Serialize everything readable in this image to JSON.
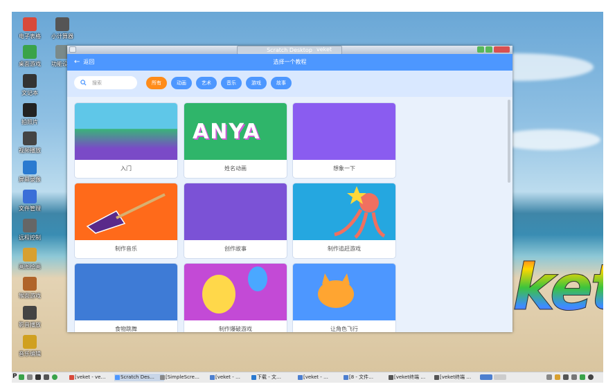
{
  "desktop": {
    "icons": [
      {
        "label": "电子表格",
        "icon": "spreadsheet-icon",
        "color": "#d84a3b"
      },
      {
        "label": "小计算器",
        "icon": "calculator-icon",
        "color": "#555555"
      },
      {
        "label": "桌面游戏",
        "icon": "game-icon",
        "color": "#3aa34a"
      },
      {
        "label": "功能设置",
        "icon": "settings-icon",
        "color": "#7a8a8a"
      },
      {
        "label": "文记本",
        "icon": "notebook-icon",
        "color": "#333333"
      },
      {
        "label": "拍照片",
        "icon": "camera-icon",
        "color": "#222222"
      },
      {
        "label": "视频播放",
        "icon": "video-player-icon",
        "color": "#444444"
      },
      {
        "label": "屏幕录像",
        "icon": "screen-recorder-icon",
        "color": "#2a7ad0"
      },
      {
        "label": "文件管理",
        "icon": "file-manager-icon",
        "color": "#3a6fd8"
      },
      {
        "label": "远程控制",
        "icon": "remote-control-icon",
        "color": "#666666"
      },
      {
        "label": "画图绘画",
        "icon": "paint-icon",
        "color": "#d8a030"
      },
      {
        "label": "猴面游戏",
        "icon": "monkey-icon",
        "color": "#b0642a"
      },
      {
        "label": "影音播放",
        "icon": "media-player-icon",
        "color": "#444444"
      },
      {
        "label": "音乐编辑",
        "icon": "music-editor-icon",
        "color": "#d0a020"
      }
    ],
    "logo_text": "ket"
  },
  "window": {
    "title": "Scratch Desktop",
    "title_right": "veket",
    "controls": [
      "minimize-icon",
      "maximize-icon",
      "close-icon"
    ]
  },
  "app": {
    "back_label": "返回",
    "header_title": "选择一个教程",
    "search_placeholder": "搜索",
    "filters": [
      {
        "label": "所有",
        "active": true
      },
      {
        "label": "动画",
        "active": false
      },
      {
        "label": "艺术",
        "active": false
      },
      {
        "label": "音乐",
        "active": false
      },
      {
        "label": "游戏",
        "active": false
      },
      {
        "label": "故事",
        "active": false
      }
    ],
    "tutorials": [
      {
        "title": "入门"
      },
      {
        "title": "姓名动画"
      },
      {
        "title": "想象一下"
      },
      {
        "title": "制作音乐"
      },
      {
        "title": "创作故事"
      },
      {
        "title": "制作追赶游戏"
      },
      {
        "title": "食物跳舞"
      },
      {
        "title": "制作爆破游戏"
      },
      {
        "title": "让角色飞行"
      }
    ],
    "anya_text": "ANYA"
  },
  "taskbar": {
    "tasks": [
      {
        "label": "[veket - ve…",
        "color": "#d84a3b"
      },
      {
        "label": "Scratch Des…",
        "color": "#4d97ff"
      },
      {
        "label": "[SimpleScre…",
        "color": "#888888"
      },
      {
        "label": "[veket - …",
        "color": "#4d7fcf"
      },
      {
        "label": "下载 - 文…",
        "color": "#2a7ad0"
      },
      {
        "label": "[veket - …",
        "color": "#4d7fcf"
      },
      {
        "label": "[8 - 文件…",
        "color": "#4d7fcf"
      },
      {
        "label": "[veket终端 …",
        "color": "#555555"
      },
      {
        "label": "[veket终端 …",
        "color": "#555555"
      }
    ],
    "start_label": "P"
  }
}
